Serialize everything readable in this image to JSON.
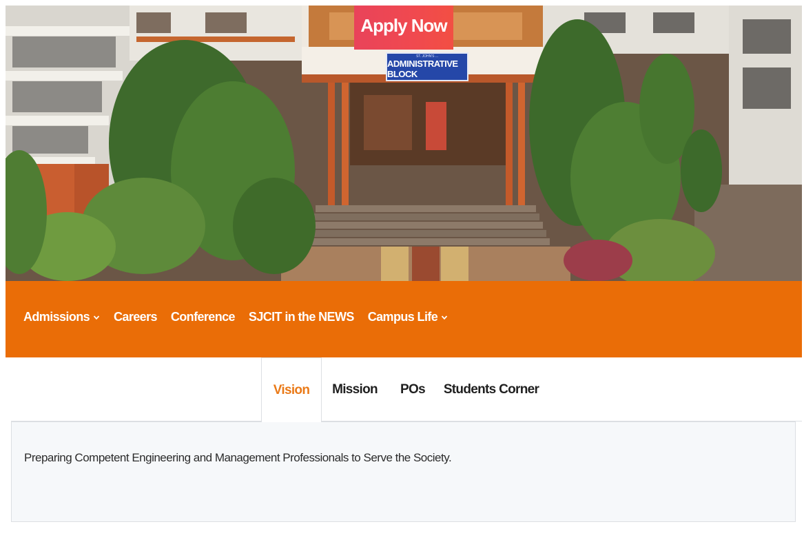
{
  "hero": {
    "apply_label": "Apply Now",
    "sign_small": "ST. JOHN'S ...",
    "sign_main": "ADMINISTRATIVE BLOCK"
  },
  "nav": {
    "items": [
      {
        "label": "Admissions",
        "dropdown": true
      },
      {
        "label": "Careers",
        "dropdown": false
      },
      {
        "label": "Conference",
        "dropdown": false
      },
      {
        "label": "SJCIT in the NEWS",
        "dropdown": false
      },
      {
        "label": "Campus Life",
        "dropdown": true
      }
    ]
  },
  "tabs": {
    "items": [
      {
        "label": "Vision",
        "active": true
      },
      {
        "label": "Mission",
        "active": false
      },
      {
        "label": "POs",
        "active": false
      },
      {
        "label": "Students Corner",
        "active": false
      }
    ],
    "panel_text": "Preparing Competent Engineering and Management Professionals to Serve the Society."
  },
  "colors": {
    "nav_bg": "#ea6d07",
    "tab_active": "#ea7a18",
    "apply_button": "#f0494f",
    "sign_bg": "#2547a8"
  }
}
